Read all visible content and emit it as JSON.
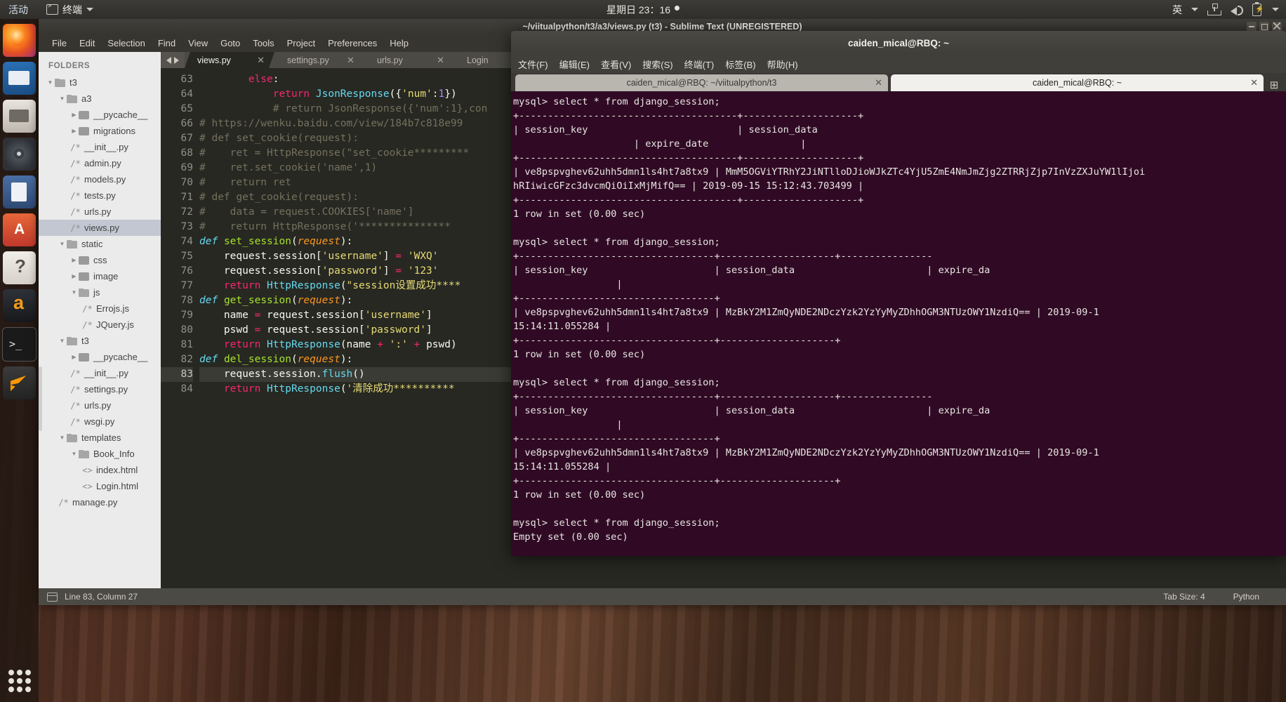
{
  "topbar": {
    "activities": "活动",
    "app_menu": "终端",
    "app_icon": "terminal-icon",
    "clock": "星期日 23：16",
    "ime": "英",
    "icons": [
      "network-icon",
      "volume-icon",
      "battery-icon",
      "chevron-down-icon"
    ]
  },
  "launcher": {
    "items": [
      {
        "name": "firefox",
        "label": "Firefox"
      },
      {
        "name": "thunderbird",
        "label": "Thunderbird Mail"
      },
      {
        "name": "files",
        "label": "Files"
      },
      {
        "name": "rhythmbox",
        "label": "Rhythmbox"
      },
      {
        "name": "libreoffice",
        "label": "LibreOffice Writer"
      },
      {
        "name": "ubuntu-software",
        "label": "Ubuntu Software"
      },
      {
        "name": "help",
        "label": "Help"
      },
      {
        "name": "amazon",
        "label": "Amazon"
      },
      {
        "name": "terminal",
        "label": "Terminal"
      },
      {
        "name": "sublime",
        "label": "Sublime Text"
      }
    ],
    "show_apps": "Show Applications"
  },
  "sublime": {
    "title": "~/viitualpython/t3/a3/views.py (t3) - Sublime Text (UNREGISTERED)",
    "menu": [
      "File",
      "Edit",
      "Selection",
      "Find",
      "View",
      "Goto",
      "Tools",
      "Project",
      "Preferences",
      "Help"
    ],
    "sidebar": {
      "header": "FOLDERS",
      "items": [
        {
          "label": "t3",
          "depth": 0,
          "type": "folder",
          "twisty": "▼",
          "open": true
        },
        {
          "label": "a3",
          "depth": 1,
          "type": "folder",
          "twisty": "▼",
          "open": true
        },
        {
          "label": "__pycache__",
          "depth": 2,
          "type": "folder",
          "twisty": "▶",
          "open": false
        },
        {
          "label": "migrations",
          "depth": 2,
          "type": "folder",
          "twisty": "▶",
          "open": false
        },
        {
          "label": "__init__.py",
          "depth": 2,
          "type": "file",
          "icon": "/*"
        },
        {
          "label": "admin.py",
          "depth": 2,
          "type": "file",
          "icon": "/*"
        },
        {
          "label": "models.py",
          "depth": 2,
          "type": "file",
          "icon": "/*"
        },
        {
          "label": "tests.py",
          "depth": 2,
          "type": "file",
          "icon": "/*"
        },
        {
          "label": "urls.py",
          "depth": 2,
          "type": "file",
          "icon": "/*"
        },
        {
          "label": "views.py",
          "depth": 2,
          "type": "file",
          "icon": "/*",
          "selected": true
        },
        {
          "label": "static",
          "depth": 1,
          "type": "folder",
          "twisty": "▼",
          "open": true
        },
        {
          "label": "css",
          "depth": 2,
          "type": "folder",
          "twisty": "▶",
          "open": false
        },
        {
          "label": "image",
          "depth": 2,
          "type": "folder",
          "twisty": "▶",
          "open": false
        },
        {
          "label": "js",
          "depth": 2,
          "type": "folder",
          "twisty": "▼",
          "open": true
        },
        {
          "label": "Errojs.js",
          "depth": 3,
          "type": "file",
          "icon": "/*"
        },
        {
          "label": "JQuery.js",
          "depth": 3,
          "type": "file",
          "icon": "/*"
        },
        {
          "label": "t3",
          "depth": 1,
          "type": "folder",
          "twisty": "▼",
          "open": true
        },
        {
          "label": "__pycache__",
          "depth": 2,
          "type": "folder",
          "twisty": "▶",
          "open": false
        },
        {
          "label": "__init__.py",
          "depth": 2,
          "type": "file",
          "icon": "/*"
        },
        {
          "label": "settings.py",
          "depth": 2,
          "type": "file",
          "icon": "/*"
        },
        {
          "label": "urls.py",
          "depth": 2,
          "type": "file",
          "icon": "/*"
        },
        {
          "label": "wsgi.py",
          "depth": 2,
          "type": "file",
          "icon": "/*"
        },
        {
          "label": "templates",
          "depth": 1,
          "type": "folder",
          "twisty": "▼",
          "open": true
        },
        {
          "label": "Book_Info",
          "depth": 2,
          "type": "folder",
          "twisty": "▼",
          "open": true
        },
        {
          "label": "index.html",
          "depth": 3,
          "type": "file",
          "icon": "<>"
        },
        {
          "label": "Login.html",
          "depth": 3,
          "type": "file",
          "icon": "<>"
        },
        {
          "label": "manage.py",
          "depth": 1,
          "type": "file",
          "icon": "/*"
        }
      ]
    },
    "tabs": [
      {
        "label": "views.py",
        "active": true,
        "close": "✕"
      },
      {
        "label": "settings.py",
        "active": false,
        "close": "✕"
      },
      {
        "label": "urls.py",
        "active": false,
        "close": "✕"
      },
      {
        "label": "Login",
        "active": false,
        "close": "✕"
      }
    ],
    "first_line_number": 63,
    "cursor_line": 83,
    "statusbar": {
      "position": "Line 83, Column 27",
      "tab_size": "Tab Size: 4",
      "syntax": "Python"
    }
  },
  "code_lines": [
    {
      "n": 63,
      "segs": [
        [
          "pl",
          "        "
        ],
        [
          "kw",
          "else"
        ],
        [
          "pl",
          ":"
        ]
      ]
    },
    {
      "n": 64,
      "segs": [
        [
          "pl",
          "            "
        ],
        [
          "kw",
          "return"
        ],
        [
          "pl",
          " "
        ],
        [
          "cls",
          "JsonResponse"
        ],
        [
          "pl",
          "({"
        ],
        [
          "str",
          "'num'"
        ],
        [
          "pl",
          ":"
        ],
        [
          "num",
          "1"
        ],
        [
          "pl",
          "})"
        ]
      ]
    },
    {
      "n": 65,
      "segs": [
        [
          "com",
          "            # return JsonResponse({'num':1},con"
        ]
      ]
    },
    {
      "n": 66,
      "segs": [
        [
          "com",
          "# https://wenku.baidu.com/view/184b7c818e99"
        ]
      ]
    },
    {
      "n": 67,
      "segs": [
        [
          "com",
          "# def set_cookie(request):"
        ]
      ]
    },
    {
      "n": 68,
      "segs": [
        [
          "com",
          "#    ret = HttpResponse(\"set_cookie*********"
        ]
      ]
    },
    {
      "n": 69,
      "segs": [
        [
          "com",
          "#    ret.set_cookie('name',1)"
        ]
      ]
    },
    {
      "n": 70,
      "segs": [
        [
          "com",
          "#    return ret"
        ]
      ]
    },
    {
      "n": 71,
      "segs": [
        [
          "com",
          "# def get_cookie(request):"
        ]
      ]
    },
    {
      "n": 72,
      "segs": [
        [
          "com",
          "#    data = request.COOKIES['name']"
        ]
      ]
    },
    {
      "n": 73,
      "segs": [
        [
          "com",
          "#    return HttpResponse('***************"
        ]
      ]
    },
    {
      "n": 74,
      "segs": [
        [
          "def",
          "def"
        ],
        [
          "pl",
          " "
        ],
        [
          "fn",
          "set_session"
        ],
        [
          "pl",
          "("
        ],
        [
          "par",
          "request"
        ],
        [
          "pl",
          "):"
        ]
      ]
    },
    {
      "n": 75,
      "segs": [
        [
          "pl",
          "    request.session["
        ],
        [
          "str",
          "'username'"
        ],
        [
          "pl",
          "] "
        ],
        [
          "op",
          "="
        ],
        [
          "pl",
          " "
        ],
        [
          "str",
          "'WXQ'"
        ]
      ]
    },
    {
      "n": 76,
      "segs": [
        [
          "pl",
          "    request.session["
        ],
        [
          "str",
          "'password'"
        ],
        [
          "pl",
          "] "
        ],
        [
          "op",
          "="
        ],
        [
          "pl",
          " "
        ],
        [
          "str",
          "'123'"
        ]
      ]
    },
    {
      "n": 77,
      "segs": [
        [
          "pl",
          "    "
        ],
        [
          "kw",
          "return"
        ],
        [
          "pl",
          " "
        ],
        [
          "cls",
          "HttpResponse"
        ],
        [
          "pl",
          "("
        ],
        [
          "str",
          "\"session设置成功****"
        ]
      ]
    },
    {
      "n": 78,
      "segs": [
        [
          "def",
          "def"
        ],
        [
          "pl",
          " "
        ],
        [
          "fn",
          "get_session"
        ],
        [
          "pl",
          "("
        ],
        [
          "par",
          "request"
        ],
        [
          "pl",
          "):"
        ]
      ]
    },
    {
      "n": 79,
      "segs": [
        [
          "pl",
          "    name "
        ],
        [
          "op",
          "="
        ],
        [
          "pl",
          " request.session["
        ],
        [
          "str",
          "'username'"
        ],
        [
          "pl",
          "]"
        ]
      ]
    },
    {
      "n": 80,
      "segs": [
        [
          "pl",
          "    pswd "
        ],
        [
          "op",
          "="
        ],
        [
          "pl",
          " request.session["
        ],
        [
          "str",
          "'password'"
        ],
        [
          "pl",
          "]"
        ]
      ]
    },
    {
      "n": 81,
      "segs": [
        [
          "pl",
          "    "
        ],
        [
          "kw",
          "return"
        ],
        [
          "pl",
          " "
        ],
        [
          "cls",
          "HttpResponse"
        ],
        [
          "pl",
          "(name "
        ],
        [
          "op",
          "+"
        ],
        [
          "pl",
          " "
        ],
        [
          "str",
          "':'"
        ],
        [
          "pl",
          " "
        ],
        [
          "op",
          "+"
        ],
        [
          "pl",
          " pswd)"
        ]
      ]
    },
    {
      "n": 82,
      "segs": [
        [
          "def",
          "def"
        ],
        [
          "pl",
          " "
        ],
        [
          "fn",
          "del_session"
        ],
        [
          "pl",
          "("
        ],
        [
          "par",
          "request"
        ],
        [
          "pl",
          "):"
        ]
      ]
    },
    {
      "n": 83,
      "segs": [
        [
          "pl",
          "    request.session."
        ],
        [
          "cls",
          "flush"
        ],
        [
          "pl",
          "()"
        ]
      ],
      "cursor": true
    },
    {
      "n": 84,
      "segs": [
        [
          "pl",
          "    "
        ],
        [
          "kw",
          "return"
        ],
        [
          "pl",
          " "
        ],
        [
          "cls",
          "HttpResponse"
        ],
        [
          "pl",
          "("
        ],
        [
          "str",
          "'清除成功**********"
        ]
      ]
    }
  ],
  "terminal": {
    "title": "caiden_mical@RBQ: ~",
    "menu": [
      "文件(F)",
      "编辑(E)",
      "查看(V)",
      "搜索(S)",
      "终端(T)",
      "标签(B)",
      "帮助(H)"
    ],
    "tabs": [
      {
        "label": "caiden_mical@RBQ: ~/viitualpython/t3",
        "active": false,
        "close": "✕"
      },
      {
        "label": "caiden_mical@RBQ: ~",
        "active": true,
        "close": "✕"
      }
    ],
    "new_tab": "⊞",
    "window_controls": [
      "minimize-icon",
      "maximize-icon",
      "close-icon"
    ],
    "content": "mysql> select * from django_session;\n+--------------------------------------+--------------------+\n| session_key                          | session_data\n                     | expire_date                |\n+--------------------------------------+--------------------+\n| ve8pspvghev62uhh5dmn1ls4ht7a8tx9 | MmM5OGViYTRhY2JiNTlloDJioWJkZTc4YjU5ZmE4NmJmZjg2ZTRRjZjp7InVzZXJuYW1lIjoi\nhRIiwicGFzc3dvcmQiOiIxMjMifQ== | 2019-09-15 15:12:43.703499 |\n+--------------------------------------+--------------------+\n1 row in set (0.00 sec)\n\nmysql> select * from django_session;\n+----------------------------------+--------------------+----------------\n| session_key                      | session_data                       | expire_da\n                  |\n+----------------------------------+\n| ve8pspvghev62uhh5dmn1ls4ht7a8tx9 | MzBkY2M1ZmQyNDE2NDczYzk2YzYyMyZDhhOGM3NTUzOWY1NzdiQ== | 2019-09-1\n15:14:11.055284 |\n+----------------------------------+--------------------+\n1 row in set (0.00 sec)\n\nmysql> select * from django_session;\n+----------------------------------+--------------------+----------------\n| session_key                      | session_data                       | expire_da\n                  |\n+----------------------------------+\n| ve8pspvghev62uhh5dmn1ls4ht7a8tx9 | MzBkY2M1ZmQyNDE2NDczYzk2YzYyMyZDhhOGM3NTUzOWY1NzdiQ== | 2019-09-1\n15:14:11.055284 |\n+----------------------------------+--------------------+\n1 row in set (0.00 sec)\n\nmysql> select * from django_session;\nEmpty set (0.00 sec)\n\nmysql> ",
    "prompt": "mysql>"
  },
  "colors": {
    "terminal_bg": "#300a24",
    "editor_bg": "#272822",
    "sidebar_bg": "#ebebeb",
    "accent_keyword": "#f92672",
    "accent_string": "#e6db74",
    "accent_function": "#a6e22e"
  }
}
